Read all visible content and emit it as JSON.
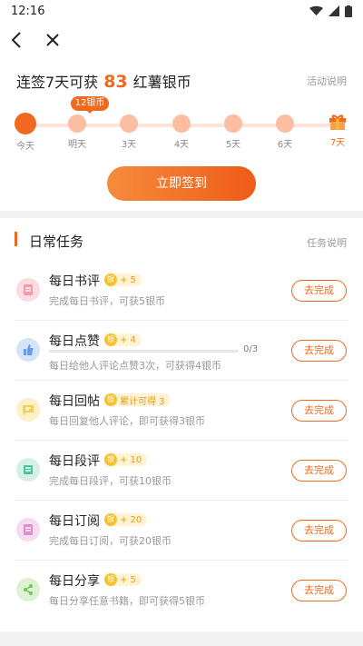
{
  "status": {
    "time": "12:16"
  },
  "checkin": {
    "title_prefix": "连签7天可获",
    "title_amount": "83",
    "title_suffix": "红薯银币",
    "activity_link": "活动说明",
    "reward_bubble": "12银币",
    "days": [
      "今天",
      "明天",
      "3天",
      "4天",
      "5天",
      "6天",
      "7天"
    ],
    "signin_button": "立即签到"
  },
  "tasks": {
    "title": "日常任务",
    "link": "任务说明",
    "items": [
      {
        "name": "每日书评",
        "reward": "+ 5",
        "desc": "完成每日书评，可获5银币",
        "button": "去完成",
        "icon": "receipt-icon",
        "color": "#f59aa8"
      },
      {
        "name": "每日点赞",
        "reward": "+ 4",
        "desc": "每日给他人评论点赞3次，可获得4银币",
        "progress": "0/3",
        "progress_fraction": 0,
        "button": "去完成",
        "icon": "thumbs-up-icon",
        "color": "#6b9be8"
      },
      {
        "name": "每日回帖",
        "reward": "累计可得 3",
        "desc": "每日回复他人评论，即可获得3银币",
        "button": "去完成",
        "icon": "comment-icon",
        "color": "#f4cf55"
      },
      {
        "name": "每日段评",
        "reward": "+ 10",
        "desc": "完成每日段评，可获10银币",
        "button": "去完成",
        "icon": "paragraph-comment-icon",
        "color": "#4ac49a"
      },
      {
        "name": "每日订阅",
        "reward": "+ 20",
        "desc": "完成每日订阅，可获20银币",
        "button": "去完成",
        "icon": "subscribe-icon",
        "color": "#e28bd1"
      },
      {
        "name": "每日分享",
        "reward": "+ 5",
        "desc": "每日分享任意书籍，即可获得5银币",
        "button": "去完成",
        "icon": "share-icon",
        "color": "#7cc35a"
      }
    ]
  },
  "colors": {
    "accent": "#f1691e",
    "coin": "#f6c12a"
  }
}
